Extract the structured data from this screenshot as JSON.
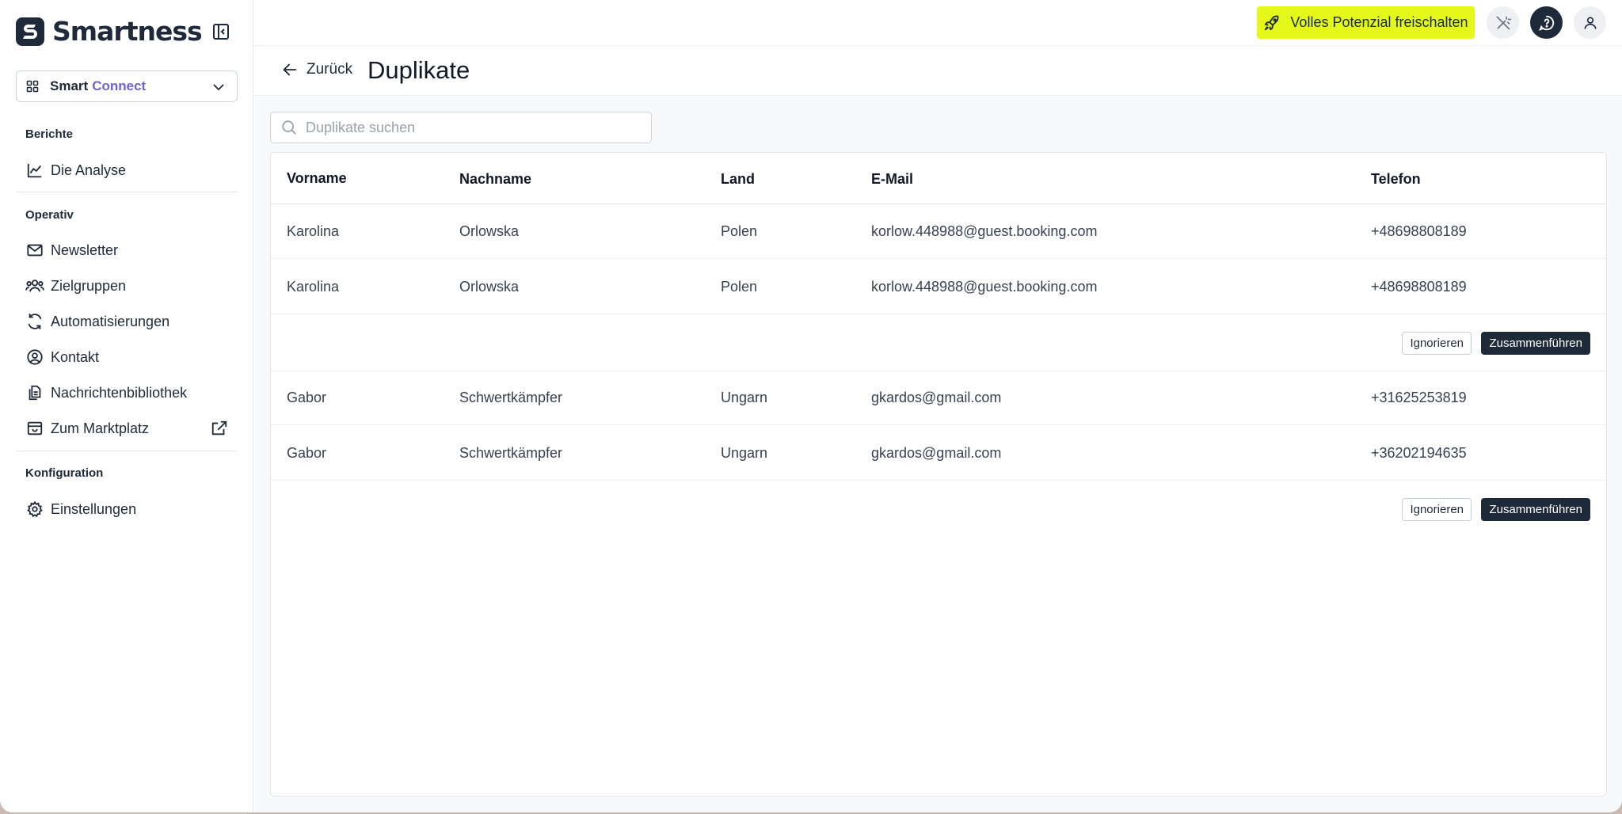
{
  "brand": {
    "name": "Smartness",
    "product_part1": "Smart",
    "product_part2": "Connect"
  },
  "colors": {
    "brand_dark": "#1e2a3a",
    "accent_purple": "#6e63c9",
    "upgrade_yellow": "#e4f91a"
  },
  "sidebar": {
    "sections": [
      {
        "title": "Berichte",
        "items": [
          {
            "label": "Die Analyse",
            "icon": "chart-line-icon"
          }
        ]
      },
      {
        "title": "Operativ",
        "items": [
          {
            "label": "Newsletter",
            "icon": "mail-icon"
          },
          {
            "label": "Zielgruppen",
            "icon": "users-icon"
          },
          {
            "label": "Automatisierungen",
            "icon": "refresh-icon"
          },
          {
            "label": "Kontakt",
            "icon": "user-circle-icon"
          },
          {
            "label": "Nachrichtenbibliothek",
            "icon": "files-icon"
          },
          {
            "label": "Zum Marktplatz",
            "icon": "store-icon"
          }
        ]
      },
      {
        "title": "Konfiguration",
        "items": [
          {
            "label": "Einstellungen",
            "icon": "gear-icon"
          }
        ]
      }
    ]
  },
  "topbar": {
    "upgrade_label": "Volles Potenzial freischalten"
  },
  "page": {
    "back_label": "Zurück",
    "title": "Duplikate"
  },
  "search": {
    "placeholder": "Duplikate suchen",
    "value": ""
  },
  "table": {
    "columns": [
      "Vorname",
      "Nachname",
      "Land",
      "E-Mail",
      "Telefon"
    ],
    "groups": [
      {
        "rows": [
          [
            "Karolina",
            "Orlowska",
            "Polen",
            "korlow.448988@guest.booking.com",
            "+48698808189"
          ],
          [
            "Karolina",
            "Orlowska",
            "Polen",
            "korlow.448988@guest.booking.com",
            "+48698808189"
          ]
        ],
        "ignore_label": "Ignorieren",
        "merge_label": "Zusammenführen"
      },
      {
        "rows": [
          [
            "Gabor",
            "Schwertkämpfer",
            "Ungarn",
            "gkardos@gmail.com",
            "+31625253819"
          ],
          [
            "Gabor",
            "Schwertkämpfer",
            "Ungarn",
            "gkardos@gmail.com",
            "+36202194635"
          ]
        ],
        "ignore_label": "Ignorieren",
        "merge_label": "Zusammenführen"
      }
    ]
  }
}
